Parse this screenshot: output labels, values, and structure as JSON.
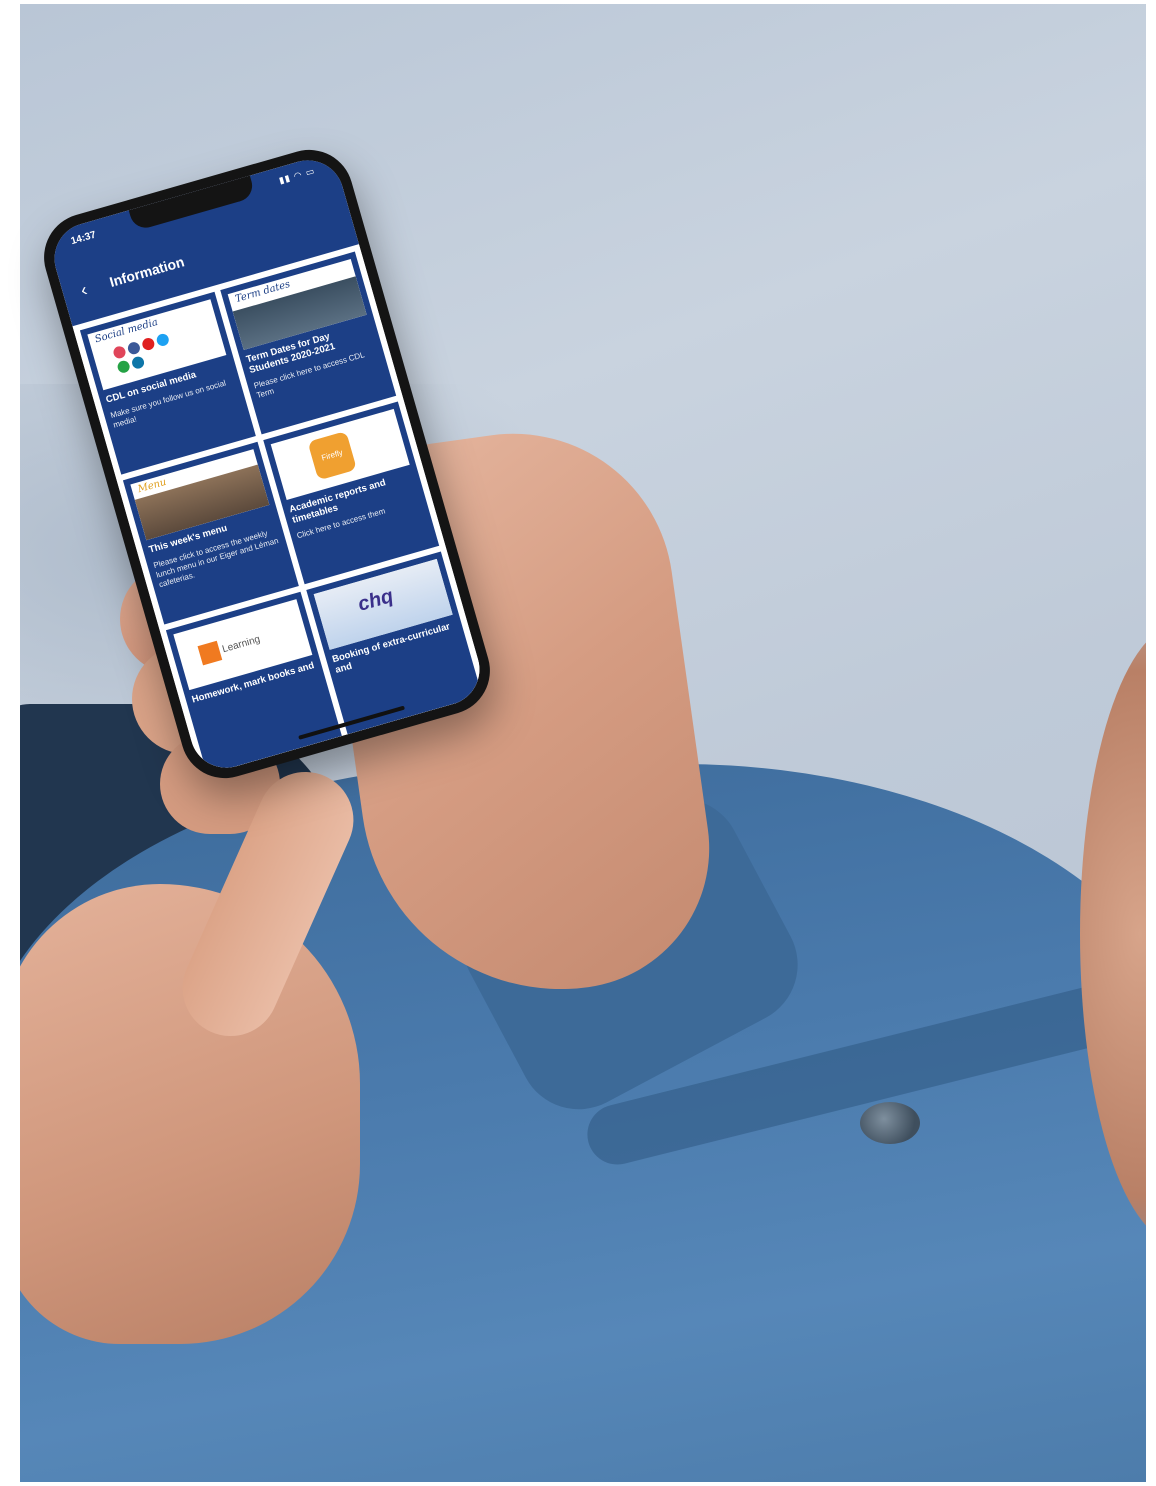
{
  "status_bar": {
    "time": "14:37",
    "icons": "▮▮ ◠ ▭"
  },
  "app_bar": {
    "back_icon": "chevron-left-icon",
    "title": "Information"
  },
  "cards": [
    {
      "id": "social",
      "image_text": "Social media",
      "title": "CDL on social media",
      "description": "Make sure you follow us on social media!"
    },
    {
      "id": "term",
      "image_text": "Term dates",
      "title": "Term Dates for Day Students 2020-2021",
      "description": "Please click here to access CDL Term"
    },
    {
      "id": "menu",
      "image_text": "Menu",
      "title": "This week's menu",
      "description": "Please click to access the weekly lunch menu in our Eiger and Léman cafeterias."
    },
    {
      "id": "reports",
      "image_text": "Firefly",
      "title": "Academic reports and timetables",
      "description": "Click here to access them"
    },
    {
      "id": "learning",
      "image_text": "Learning",
      "title": "Homework, mark books and",
      "description": ""
    },
    {
      "id": "chq",
      "image_text": "chq",
      "title": "Booking of extra-curricular and",
      "description": ""
    }
  ],
  "colors": {
    "app_blue": "#1c3f86",
    "social_dots": [
      "#e0455a",
      "#3b5998",
      "#e02020",
      "#1da1f2",
      "#25a245",
      "#0e76a8"
    ]
  }
}
